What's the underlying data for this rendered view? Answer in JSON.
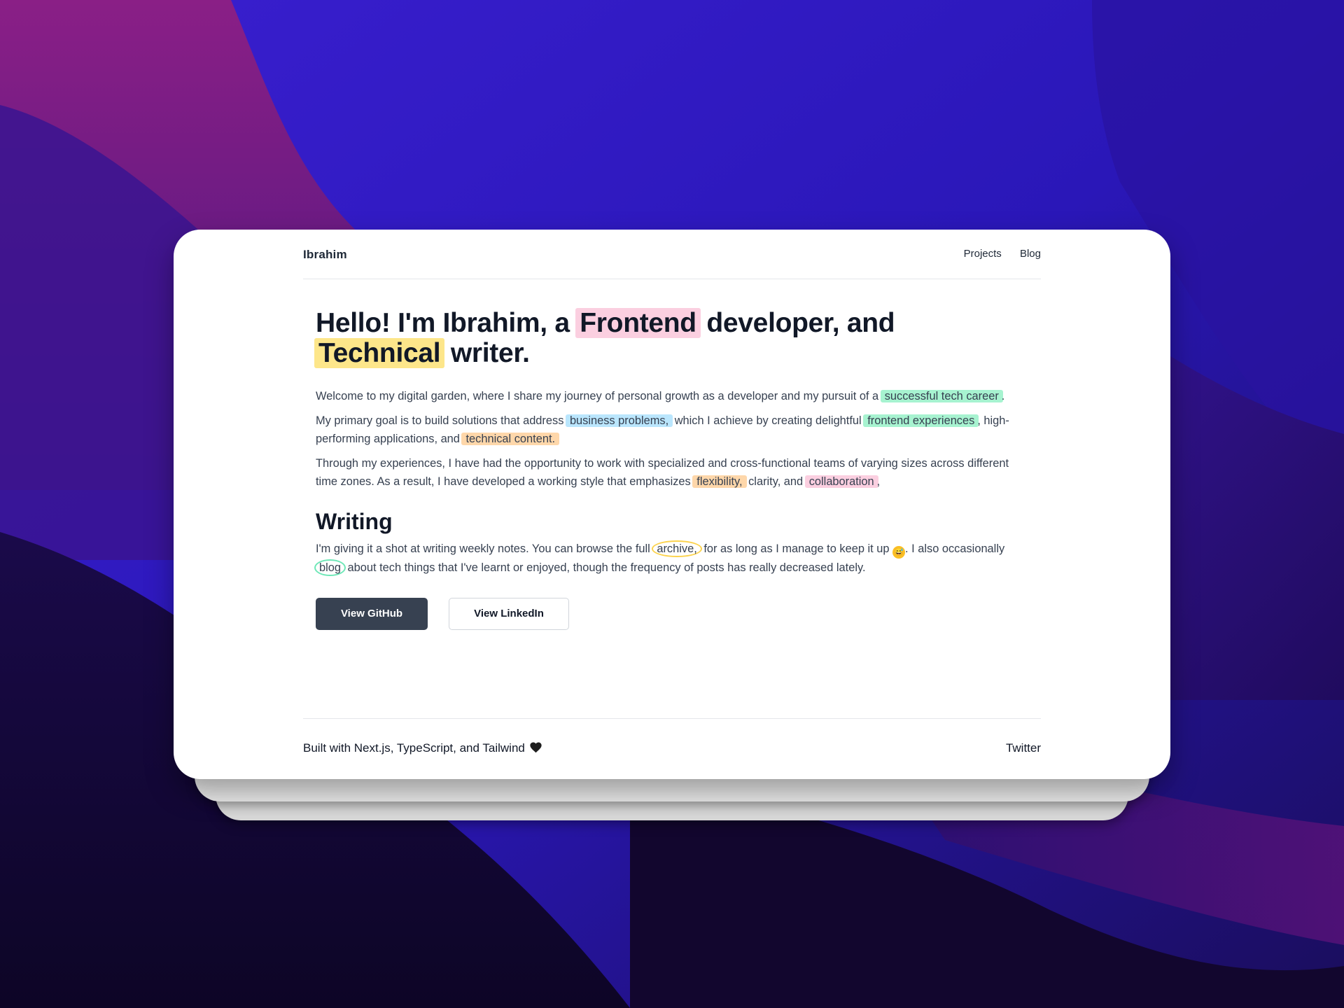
{
  "colors": {
    "background": "#2a1570",
    "card": "#ffffff",
    "text": "#111827",
    "button_dark": "#374151",
    "highlight_pink": "#fbcfe0",
    "highlight_yellow": "#fde68a",
    "highlight_green": "#a7f3d0",
    "highlight_blue": "#bae6fd",
    "highlight_orange": "#fed7aa"
  },
  "nav": {
    "brand": "Ibrahim",
    "links": [
      "Projects",
      "Blog"
    ]
  },
  "hero": {
    "title_1": "Hello! I'm Ibrahim, a ",
    "title_hl_1": "Frontend",
    "title_2": " developer, and",
    "title_hl_2": "Technical",
    "title_3": " writer."
  },
  "intro": {
    "p1_a": "Welcome to my digital garden, where I share my journey of personal growth as a developer and my pursuit of a ",
    "p1_hl": "successful tech career",
    "p1_b": ".",
    "p2_a": "My primary goal is to build solutions that address ",
    "p2_hl1": "business problems,",
    "p2_b": " which I achieve by creating delightful ",
    "p2_hl2": "frontend experiences",
    "p2_c": ", high-performing applications, and ",
    "p2_hl3": "technical content.",
    "p3_a": "Through my experiences, I have had the opportunity to work with specialized and cross-functional teams of varying sizes across different time zones. As a result, I have developed a working style that emphasizes ",
    "p3_hl1": "flexibility,",
    "p3_b": " clarity, and ",
    "p3_hl2": "collaboration",
    "p3_c": ","
  },
  "writing": {
    "heading": "Writing",
    "a": "I'm giving it a shot at writing weekly notes. You can browse the full ",
    "archive": "archive,",
    "b": " for as long as I manage to keep it up ",
    "emoji": "😅",
    "c": ". I also occasionally ",
    "blog": "blog",
    "d": " about tech things that I've learnt or enjoyed, though the frequency of posts has really decreased lately."
  },
  "buttons": {
    "github": "View GitHub",
    "linkedin": "View LinkedIn"
  },
  "footer": {
    "built_with": "Built with Next.js, TypeScript, and Tailwind",
    "heart_icon": "black-heart-icon",
    "twitter": "Twitter"
  }
}
